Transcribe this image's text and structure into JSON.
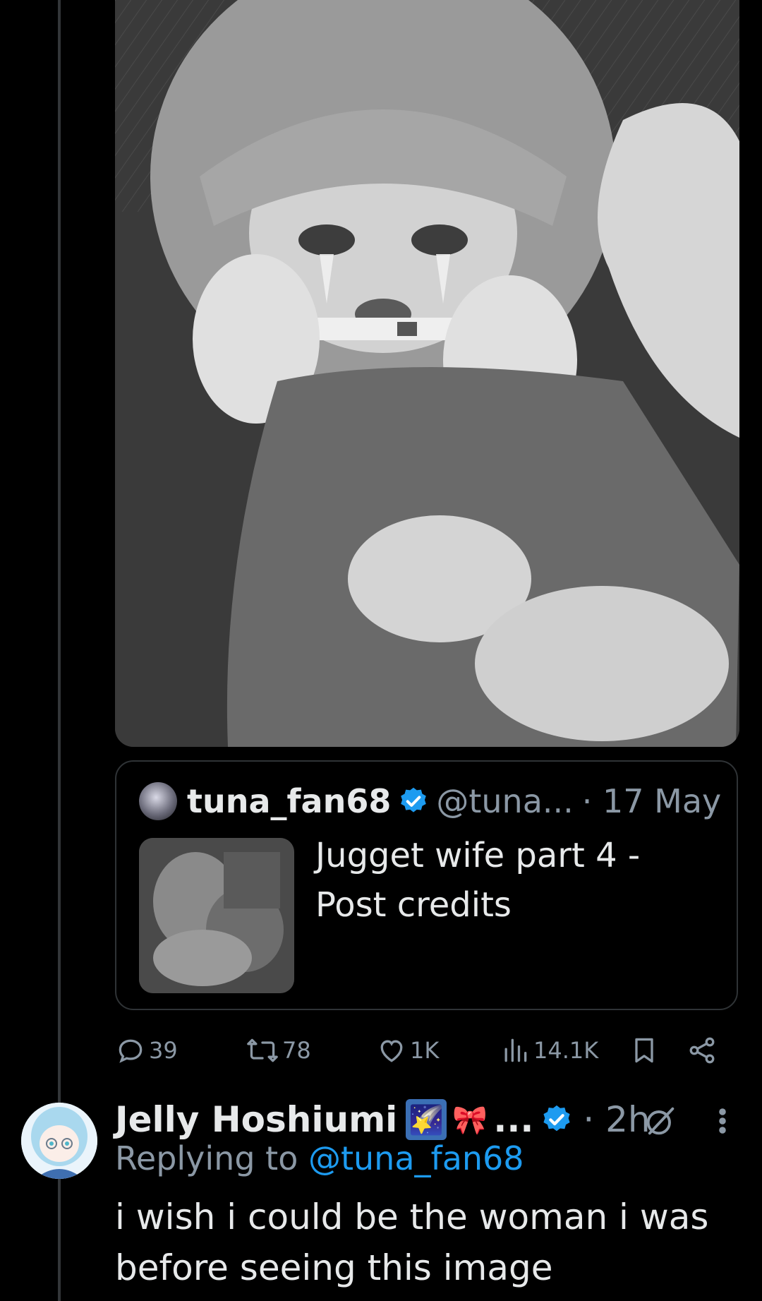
{
  "quote": {
    "author_name": "tuna_fan68",
    "handle": "@tuna...",
    "date": "· 17 May",
    "text": "Jugget wife part 4 - Post credits"
  },
  "actions": {
    "replies": "39",
    "reposts": "78",
    "likes": "1K",
    "views": "14.1K"
  },
  "reply": {
    "author_name": "Jelly Hoshiumi",
    "emoji_1": "🌠",
    "emoji_2": "🎀",
    "ellipsis": "...",
    "time": "· 2h",
    "replying_prefix": "Replying to",
    "replying_to": "@tuna_fan68",
    "text": "i wish i could be the woman i was before seeing this image"
  },
  "icons": {
    "reply": "comment-icon",
    "repost": "repost-icon",
    "like": "heart-icon",
    "views": "views-chart-icon",
    "bookmark": "bookmark-icon",
    "share": "share-icon",
    "verified": "verified-badge-icon",
    "grok": "grok-icon",
    "more": "more-vertical-icon"
  },
  "colors": {
    "background": "#000000",
    "text_primary": "#e7e9ea",
    "text_secondary": "#8b98a5",
    "accent": "#1d9bf0",
    "border": "#2f3336"
  }
}
